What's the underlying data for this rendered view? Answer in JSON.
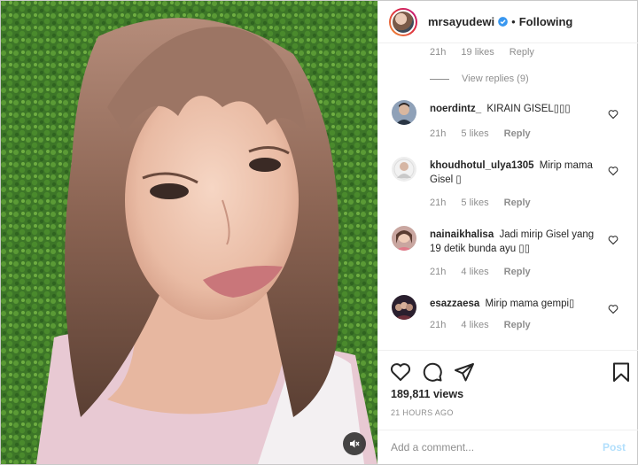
{
  "post": {
    "username": "mrsayudewi",
    "verified": true,
    "separator": "•",
    "follow_status": "Following"
  },
  "previous_comment": {
    "time": "21h",
    "likes": "19 likes",
    "reply_label": "Reply",
    "view_replies": "View replies (9)"
  },
  "comments": [
    {
      "username": "noerdintz_",
      "text": "KIRAIN GISEL▯▯▯",
      "time": "21h",
      "likes": "5 likes",
      "reply_label": "Reply"
    },
    {
      "username": "khoudhotul_ulya1305",
      "text": "Mirip mama Gisel ▯",
      "time": "21h",
      "likes": "5 likes",
      "reply_label": "Reply"
    },
    {
      "username": "nainaikhalisa",
      "text": "Jadi mirip Gisel yang 19 detik bunda ayu ▯▯",
      "time": "21h",
      "likes": "4 likes",
      "reply_label": "Reply"
    },
    {
      "username": "esazzaesa",
      "text": "Mirip mama gempi▯",
      "time": "21h",
      "likes": "4 likes",
      "reply_label": "Reply"
    }
  ],
  "stats": {
    "views": "189,811 views",
    "time_ago": "21 HOURS AGO"
  },
  "composer": {
    "placeholder": "Add a comment...",
    "post_label": "Post"
  },
  "icons": {
    "like": "heart-icon",
    "comment": "comment-icon",
    "share": "paper-plane-icon",
    "save": "bookmark-icon",
    "mute": "speaker-muted-icon",
    "verified": "verified-badge-icon"
  },
  "colors": {
    "verified": "#3897f0",
    "post_disabled": "#b2dffc",
    "muted_text": "#8e8e8e",
    "primary_text": "#262626"
  }
}
